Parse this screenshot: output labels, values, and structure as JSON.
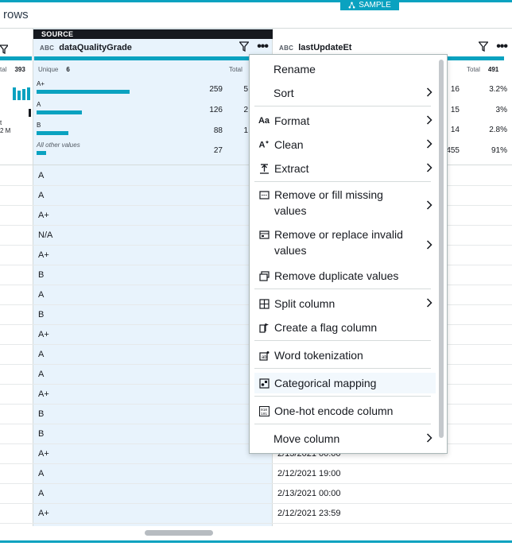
{
  "header": {
    "rows_label": "rows",
    "sample_badge": "SAMPLE"
  },
  "left_column": {
    "total_label": "tal",
    "total_value": "393",
    "extra_label": "t",
    "extra_value": "2 M"
  },
  "source_column": {
    "source_tag": "SOURCE",
    "type": "ABC",
    "name": "dataQualityGrade",
    "unique_label": "Unique",
    "unique_value": "6",
    "total_label": "Total",
    "values": [
      {
        "label": "A+",
        "count": "259",
        "pct": "5",
        "fraction": 0.53
      },
      {
        "label": "A",
        "count": "126",
        "pct": "2",
        "fraction": 0.26
      },
      {
        "label": "B",
        "count": "88",
        "pct": "1",
        "fraction": 0.18
      },
      {
        "label": "All other values",
        "count": "27",
        "pct": "",
        "fraction": 0.055
      }
    ]
  },
  "right_column": {
    "type": "ABC",
    "name": "lastUpdateEt",
    "total_label": "Total",
    "total_value": "491",
    "stats": [
      {
        "count": "16",
        "pct": "3.2%"
      },
      {
        "count": "15",
        "pct": "3%"
      },
      {
        "count": "14",
        "pct": "2.8%"
      },
      {
        "count": "455",
        "pct": "91%"
      }
    ]
  },
  "rows": [
    {
      "grade": "A",
      "date": ""
    },
    {
      "grade": "A",
      "date": ""
    },
    {
      "grade": "A+",
      "date": ""
    },
    {
      "grade": "N/A",
      "date": ""
    },
    {
      "grade": "A+",
      "date": ""
    },
    {
      "grade": "B",
      "date": ""
    },
    {
      "grade": "A",
      "date": ""
    },
    {
      "grade": "B",
      "date": ""
    },
    {
      "grade": "A+",
      "date": ""
    },
    {
      "grade": "A",
      "date": ""
    },
    {
      "grade": "A",
      "date": ""
    },
    {
      "grade": "A+",
      "date": ""
    },
    {
      "grade": "B",
      "date": ""
    },
    {
      "grade": "B",
      "date": ""
    },
    {
      "grade": "A+",
      "date": "2/13/2021 00:00"
    },
    {
      "grade": "A",
      "date": "2/12/2021 19:00"
    },
    {
      "grade": "A",
      "date": "2/13/2021 00:00"
    },
    {
      "grade": "A+",
      "date": "2/12/2021 23:59"
    }
  ],
  "menu": {
    "items": [
      {
        "label": "Rename",
        "icon": "",
        "chevron": false
      },
      {
        "label": "Sort",
        "icon": "",
        "chevron": true
      },
      {
        "label": "Format",
        "icon": "format-icon",
        "chevron": true
      },
      {
        "label": "Clean",
        "icon": "clean-icon",
        "chevron": true
      },
      {
        "label": "Extract",
        "icon": "extract-icon",
        "chevron": true
      },
      {
        "label": "Remove or fill missing values",
        "icon": "missing-values-icon",
        "chevron": true
      },
      {
        "label": "Remove or replace invalid values",
        "icon": "invalid-values-icon",
        "chevron": true
      },
      {
        "label": "Remove duplicate values",
        "icon": "duplicate-values-icon",
        "chevron": false
      },
      {
        "label": "Split column",
        "icon": "split-column-icon",
        "chevron": true
      },
      {
        "label": "Create a flag column",
        "icon": "flag-column-icon",
        "chevron": false
      },
      {
        "label": "Word tokenization",
        "icon": "tokenization-icon",
        "chevron": false
      },
      {
        "label": "Categorical mapping",
        "icon": "categorical-mapping-icon",
        "chevron": false
      },
      {
        "label": "One-hot encode column",
        "icon": "one-hot-encode-icon",
        "chevron": false
      },
      {
        "label": "Move column",
        "icon": "",
        "chevron": true
      }
    ]
  },
  "colors": {
    "accent": "#0aa2c0",
    "selected_column_bg": "#e8f3fc",
    "source_tag_bg": "#16191f"
  }
}
